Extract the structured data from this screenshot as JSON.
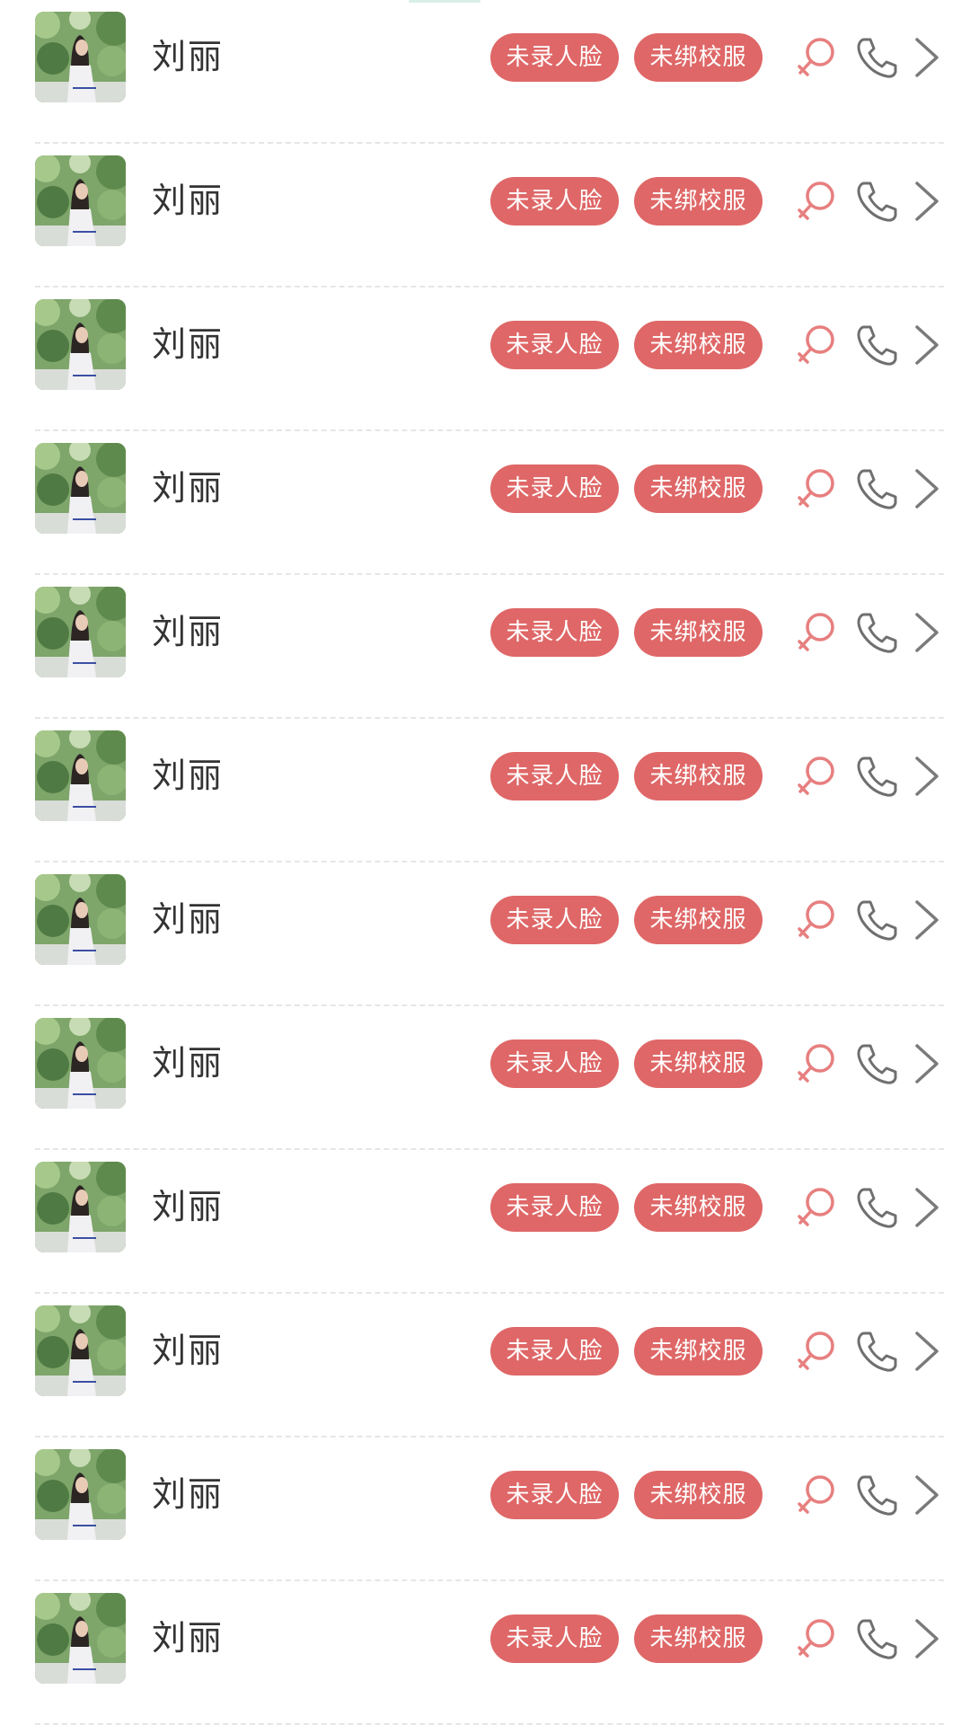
{
  "students": [
    {
      "name": "刘丽",
      "tags": [
        "未录人脸",
        "未绑校服"
      ],
      "gender_icon": "female-icon",
      "phone_icon": "phone-icon",
      "detail_icon": "chevron-right-icon"
    },
    {
      "name": "刘丽",
      "tags": [
        "未录人脸",
        "未绑校服"
      ],
      "gender_icon": "female-icon",
      "phone_icon": "phone-icon",
      "detail_icon": "chevron-right-icon"
    },
    {
      "name": "刘丽",
      "tags": [
        "未录人脸",
        "未绑校服"
      ],
      "gender_icon": "female-icon",
      "phone_icon": "phone-icon",
      "detail_icon": "chevron-right-icon"
    },
    {
      "name": "刘丽",
      "tags": [
        "未录人脸",
        "未绑校服"
      ],
      "gender_icon": "female-icon",
      "phone_icon": "phone-icon",
      "detail_icon": "chevron-right-icon"
    },
    {
      "name": "刘丽",
      "tags": [
        "未录人脸",
        "未绑校服"
      ],
      "gender_icon": "female-icon",
      "phone_icon": "phone-icon",
      "detail_icon": "chevron-right-icon"
    },
    {
      "name": "刘丽",
      "tags": [
        "未录人脸",
        "未绑校服"
      ],
      "gender_icon": "female-icon",
      "phone_icon": "phone-icon",
      "detail_icon": "chevron-right-icon"
    },
    {
      "name": "刘丽",
      "tags": [
        "未录人脸",
        "未绑校服"
      ],
      "gender_icon": "female-icon",
      "phone_icon": "phone-icon",
      "detail_icon": "chevron-right-icon"
    },
    {
      "name": "刘丽",
      "tags": [
        "未录人脸",
        "未绑校服"
      ],
      "gender_icon": "female-icon",
      "phone_icon": "phone-icon",
      "detail_icon": "chevron-right-icon"
    },
    {
      "name": "刘丽",
      "tags": [
        "未录人脸",
        "未绑校服"
      ],
      "gender_icon": "female-icon",
      "phone_icon": "phone-icon",
      "detail_icon": "chevron-right-icon"
    },
    {
      "name": "刘丽",
      "tags": [
        "未录人脸",
        "未绑校服"
      ],
      "gender_icon": "female-icon",
      "phone_icon": "phone-icon",
      "detail_icon": "chevron-right-icon"
    },
    {
      "name": "刘丽",
      "tags": [
        "未录人脸",
        "未绑校服"
      ],
      "gender_icon": "female-icon",
      "phone_icon": "phone-icon",
      "detail_icon": "chevron-right-icon"
    },
    {
      "name": "刘丽",
      "tags": [
        "未录人脸",
        "未绑校服"
      ],
      "gender_icon": "female-icon",
      "phone_icon": "phone-icon",
      "detail_icon": "chevron-right-icon"
    }
  ],
  "colors": {
    "tag_background": "#df6767",
    "tag_text": "#ffffff",
    "female_icon": "#e77f7f",
    "phone_icon": "#6f6f6f",
    "arrow_icon": "#7a7a7a",
    "name_text": "#333333",
    "divider": "#e6e6e6"
  }
}
